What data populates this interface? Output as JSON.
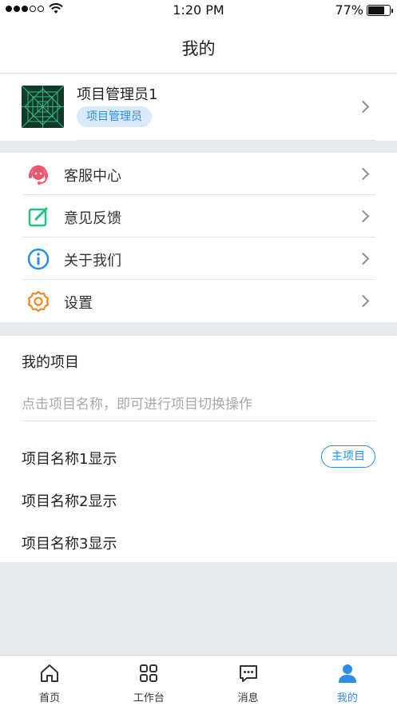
{
  "status": {
    "time": "1:20 PM",
    "battery": "77%",
    "battery_level": 0.77
  },
  "nav": {
    "title": "我的"
  },
  "profile": {
    "name": "项目管理员1",
    "role": "项目管理员"
  },
  "menu": {
    "items": [
      {
        "label": "客服中心",
        "icon": "customer-service-icon"
      },
      {
        "label": "意见反馈",
        "icon": "feedback-edit-icon"
      },
      {
        "label": "关于我们",
        "icon": "info-icon"
      },
      {
        "label": "设置",
        "icon": "settings-gear-icon"
      }
    ]
  },
  "projects": {
    "title": "我的项目",
    "hint": "点击项目名称，即可进行项目切换操作",
    "items": [
      {
        "name": "项目名称1显示",
        "badge": "主项目"
      },
      {
        "name": "项目名称2显示"
      },
      {
        "name": "项目名称3显示"
      }
    ]
  },
  "tabs": [
    {
      "label": "首页",
      "icon": "home-icon"
    },
    {
      "label": "工作台",
      "icon": "workbench-grid-icon"
    },
    {
      "label": "消息",
      "icon": "message-icon"
    },
    {
      "label": "我的",
      "icon": "user-icon",
      "active": true
    }
  ],
  "colors": {
    "accent": "#2c8ee8",
    "service": "#f0566a",
    "feedback": "#2bbf7e",
    "info": "#2c8ee8",
    "settings": "#f08a24"
  }
}
